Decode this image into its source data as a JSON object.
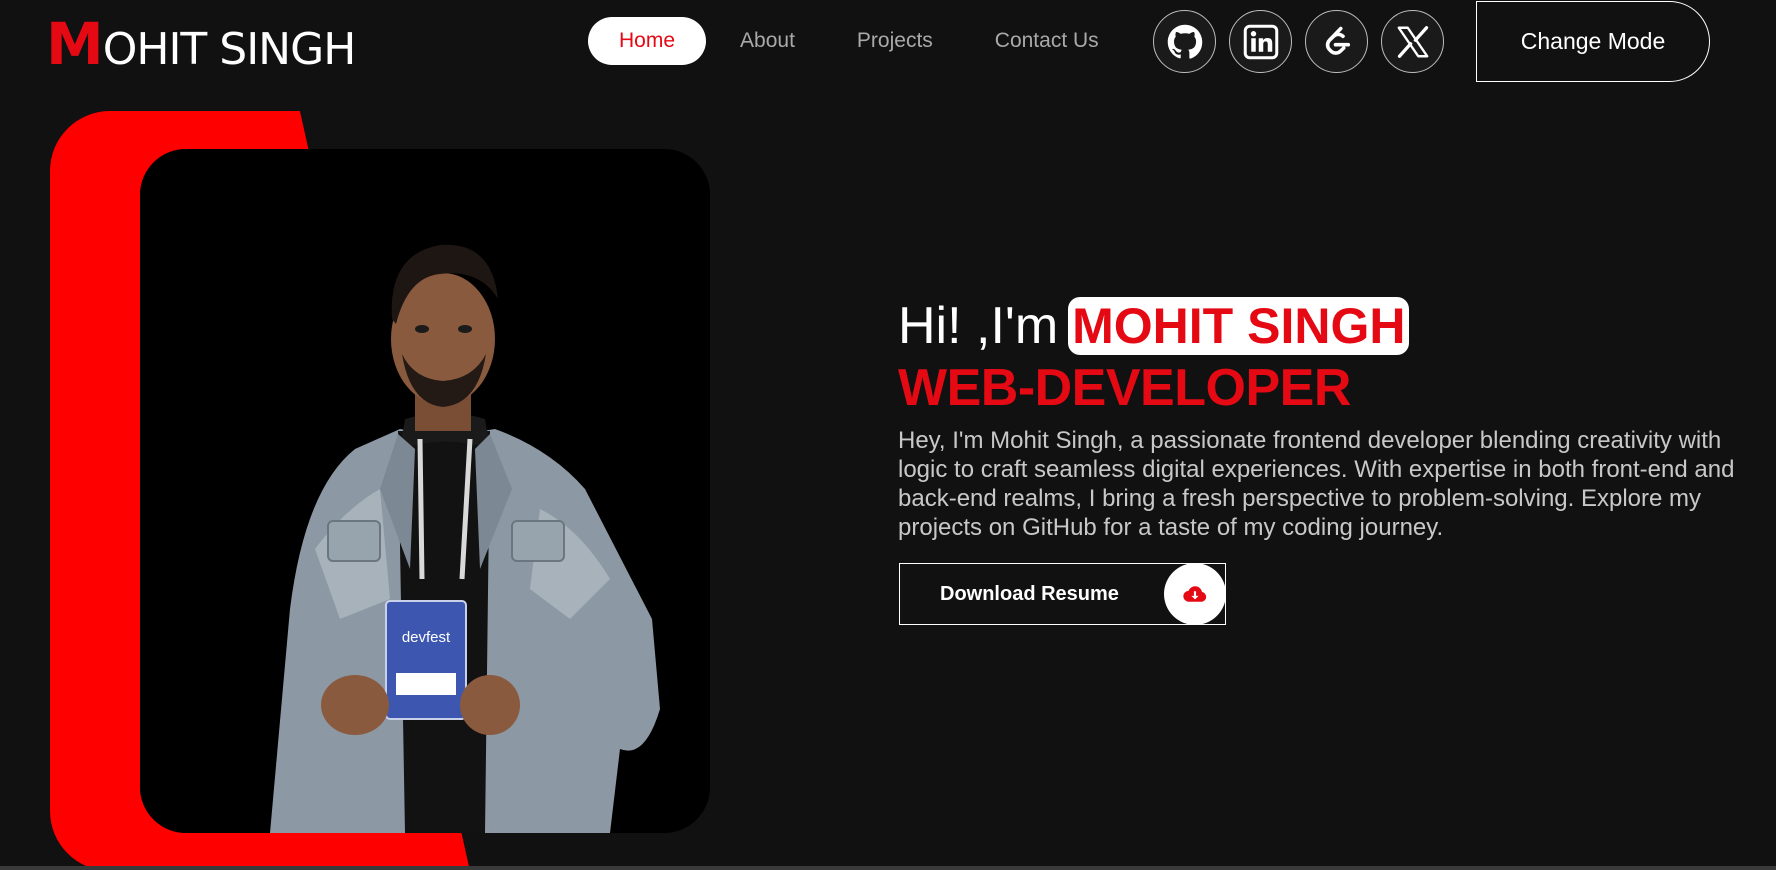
{
  "header": {
    "logo_initial": "M",
    "logo_rest": "OHIT SINGH",
    "nav": [
      "Home",
      "About",
      "Projects",
      "Contact Us"
    ],
    "active_nav": "Home",
    "socials": [
      "github-icon",
      "linkedin-icon",
      "leetcode-icon",
      "x-icon"
    ],
    "mode_button": "Change Mode"
  },
  "hero": {
    "greeting_prefix": "Hi! ,I'm",
    "name": "MOHIT SINGH",
    "role": "WEB-DEVELOPER",
    "bio": "Hey, I'm Mohit Singh, a passionate frontend developer blending creativity with logic to craft seamless digital experiences. With expertise in both front-end and back-end realms, I bring a fresh perspective to problem-solving. Explore my projects on GitHub for a taste of my coding journey.",
    "resume_button": "Download Resume",
    "resume_icon": "cloud-download-icon",
    "badge_text": "devfest"
  },
  "colors": {
    "background": "#111111",
    "accent_red": "#e50914",
    "panel_red": "#ff0000",
    "nav_text": "#a9a9a9",
    "white": "#ffffff"
  }
}
